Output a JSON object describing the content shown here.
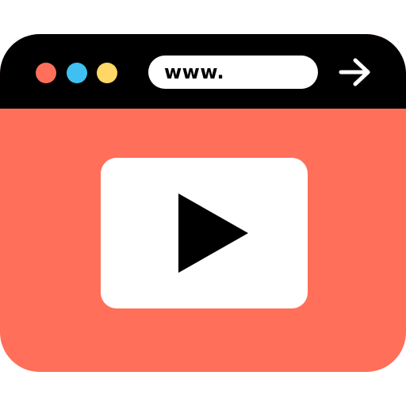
{
  "browser": {
    "address_bar": {
      "text": "www.",
      "go_icon": "arrow-right-icon"
    },
    "window_controls": [
      {
        "name": "close",
        "color": "#ff6f5a"
      },
      {
        "name": "minimize",
        "color": "#3fc0f0"
      },
      {
        "name": "maximize",
        "color": "#ffd766"
      }
    ],
    "colors": {
      "titlebar": "#000000",
      "content_background": "#ff6f5a",
      "player_background": "#ffffff",
      "play_icon": "#000000"
    }
  },
  "player": {
    "icon": "play-icon"
  }
}
